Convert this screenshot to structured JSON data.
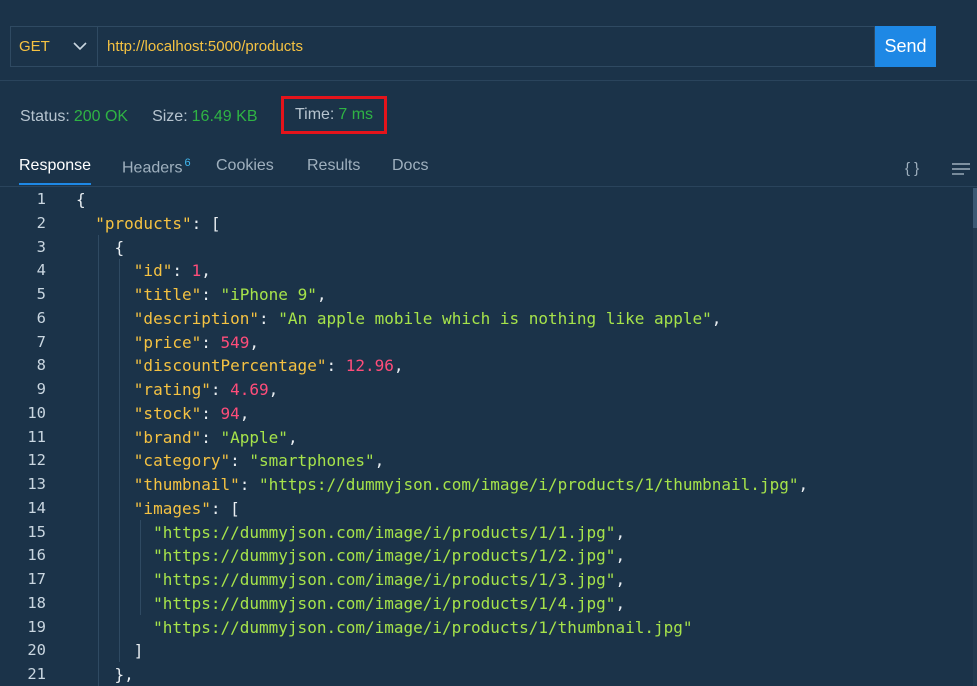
{
  "request": {
    "method": "GET",
    "url": "http://localhost:5000/products",
    "send_label": "Send"
  },
  "status": {
    "status_label": "Status:",
    "status_value": "200 OK",
    "size_label": "Size:",
    "size_value": "16.49 KB",
    "time_label": "Time:",
    "time_value": "7 ms"
  },
  "tabs": [
    {
      "label": "Response",
      "active": true
    },
    {
      "label": "Headers",
      "badge": "6"
    },
    {
      "label": "Cookies"
    },
    {
      "label": "Results"
    },
    {
      "label": "Docs"
    }
  ],
  "icons": {
    "braces": "{ }",
    "menu": "menu-icon"
  },
  "colors": {
    "background": "#1b3349",
    "accent": "#1e88e5",
    "success": "#2fb344",
    "highlight": "#e5141b",
    "json_key": "#f5c242",
    "json_string": "#a6e34a",
    "json_number": "#ff4d7a"
  },
  "response_lines": [
    [
      {
        "t": "p",
        "v": "{"
      }
    ],
    [
      {
        "t": "p",
        "v": "  "
      },
      {
        "t": "k",
        "v": "\"products\""
      },
      {
        "t": "p",
        "v": ": ["
      }
    ],
    [
      {
        "t": "p",
        "v": "    {"
      }
    ],
    [
      {
        "t": "p",
        "v": "      "
      },
      {
        "t": "k",
        "v": "\"id\""
      },
      {
        "t": "p",
        "v": ": "
      },
      {
        "t": "n",
        "v": "1"
      },
      {
        "t": "p",
        "v": ","
      }
    ],
    [
      {
        "t": "p",
        "v": "      "
      },
      {
        "t": "k",
        "v": "\"title\""
      },
      {
        "t": "p",
        "v": ": "
      },
      {
        "t": "s",
        "v": "\"iPhone 9\""
      },
      {
        "t": "p",
        "v": ","
      }
    ],
    [
      {
        "t": "p",
        "v": "      "
      },
      {
        "t": "k",
        "v": "\"description\""
      },
      {
        "t": "p",
        "v": ": "
      },
      {
        "t": "s",
        "v": "\"An apple mobile which is nothing like apple\""
      },
      {
        "t": "p",
        "v": ","
      }
    ],
    [
      {
        "t": "p",
        "v": "      "
      },
      {
        "t": "k",
        "v": "\"price\""
      },
      {
        "t": "p",
        "v": ": "
      },
      {
        "t": "n",
        "v": "549"
      },
      {
        "t": "p",
        "v": ","
      }
    ],
    [
      {
        "t": "p",
        "v": "      "
      },
      {
        "t": "k",
        "v": "\"discountPercentage\""
      },
      {
        "t": "p",
        "v": ": "
      },
      {
        "t": "n",
        "v": "12.96"
      },
      {
        "t": "p",
        "v": ","
      }
    ],
    [
      {
        "t": "p",
        "v": "      "
      },
      {
        "t": "k",
        "v": "\"rating\""
      },
      {
        "t": "p",
        "v": ": "
      },
      {
        "t": "n",
        "v": "4.69"
      },
      {
        "t": "p",
        "v": ","
      }
    ],
    [
      {
        "t": "p",
        "v": "      "
      },
      {
        "t": "k",
        "v": "\"stock\""
      },
      {
        "t": "p",
        "v": ": "
      },
      {
        "t": "n",
        "v": "94"
      },
      {
        "t": "p",
        "v": ","
      }
    ],
    [
      {
        "t": "p",
        "v": "      "
      },
      {
        "t": "k",
        "v": "\"brand\""
      },
      {
        "t": "p",
        "v": ": "
      },
      {
        "t": "s",
        "v": "\"Apple\""
      },
      {
        "t": "p",
        "v": ","
      }
    ],
    [
      {
        "t": "p",
        "v": "      "
      },
      {
        "t": "k",
        "v": "\"category\""
      },
      {
        "t": "p",
        "v": ": "
      },
      {
        "t": "s",
        "v": "\"smartphones\""
      },
      {
        "t": "p",
        "v": ","
      }
    ],
    [
      {
        "t": "p",
        "v": "      "
      },
      {
        "t": "k",
        "v": "\"thumbnail\""
      },
      {
        "t": "p",
        "v": ": "
      },
      {
        "t": "s",
        "v": "\"https://dummyjson.com/image/i/products/1/thumbnail.jpg\""
      },
      {
        "t": "p",
        "v": ","
      }
    ],
    [
      {
        "t": "p",
        "v": "      "
      },
      {
        "t": "k",
        "v": "\"images\""
      },
      {
        "t": "p",
        "v": ": ["
      }
    ],
    [
      {
        "t": "p",
        "v": "        "
      },
      {
        "t": "s",
        "v": "\"https://dummyjson.com/image/i/products/1/1.jpg\""
      },
      {
        "t": "p",
        "v": ","
      }
    ],
    [
      {
        "t": "p",
        "v": "        "
      },
      {
        "t": "s",
        "v": "\"https://dummyjson.com/image/i/products/1/2.jpg\""
      },
      {
        "t": "p",
        "v": ","
      }
    ],
    [
      {
        "t": "p",
        "v": "        "
      },
      {
        "t": "s",
        "v": "\"https://dummyjson.com/image/i/products/1/3.jpg\""
      },
      {
        "t": "p",
        "v": ","
      }
    ],
    [
      {
        "t": "p",
        "v": "        "
      },
      {
        "t": "s",
        "v": "\"https://dummyjson.com/image/i/products/1/4.jpg\""
      },
      {
        "t": "p",
        "v": ","
      }
    ],
    [
      {
        "t": "p",
        "v": "        "
      },
      {
        "t": "s",
        "v": "\"https://dummyjson.com/image/i/products/1/thumbnail.jpg\""
      }
    ],
    [
      {
        "t": "p",
        "v": "      ]"
      }
    ],
    [
      {
        "t": "p",
        "v": "    },"
      }
    ]
  ]
}
